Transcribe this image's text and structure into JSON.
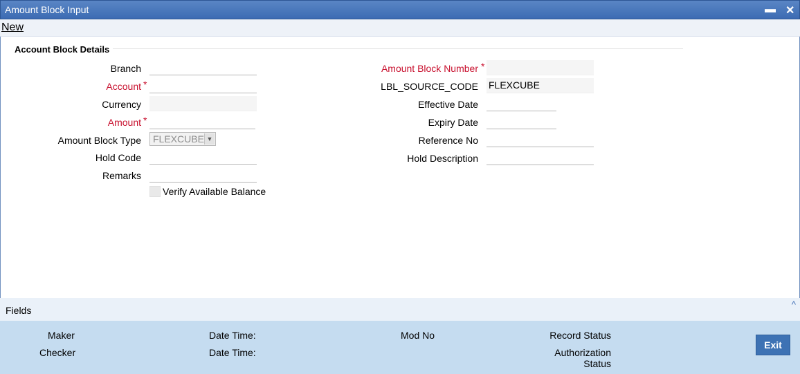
{
  "window": {
    "title": "Amount Block Input",
    "minimize": "▬",
    "close": "✕"
  },
  "toolbar": {
    "new_label": "New"
  },
  "section": {
    "title": "Account Block Details"
  },
  "left": {
    "branch_label": "Branch",
    "account_label": "Account",
    "currency_label": "Currency",
    "amount_label": "Amount",
    "amount_block_type_label": "Amount Block Type",
    "amount_block_type_value": "FLEXCUBE",
    "hold_code_label": "Hold Code",
    "remarks_label": "Remarks",
    "verify_label": "Verify Available Balance",
    "required_mark": "*"
  },
  "right": {
    "amount_block_number_label": "Amount Block Number",
    "source_code_label": "LBL_SOURCE_CODE",
    "source_code_value": "FLEXCUBE",
    "effective_date_label": "Effective Date",
    "expiry_date_label": "Expiry Date",
    "reference_no_label": "Reference No",
    "hold_description_label": "Hold Description"
  },
  "fields_bar": {
    "label": "Fields",
    "caret": "^"
  },
  "footer": {
    "maker_label": "Maker",
    "checker_label": "Checker",
    "date_time_label_1": "Date Time:",
    "date_time_label_2": "Date Time:",
    "mod_no_label": "Mod No",
    "record_status_label": "Record Status",
    "authorization_label_1": "Authorization",
    "authorization_label_2": "Status",
    "exit_label": "Exit"
  },
  "colors": {
    "title_bar": "#3c6bb3",
    "required": "#c8102e",
    "footer": "#c5dcf0",
    "exit_button": "#3d72b4"
  }
}
